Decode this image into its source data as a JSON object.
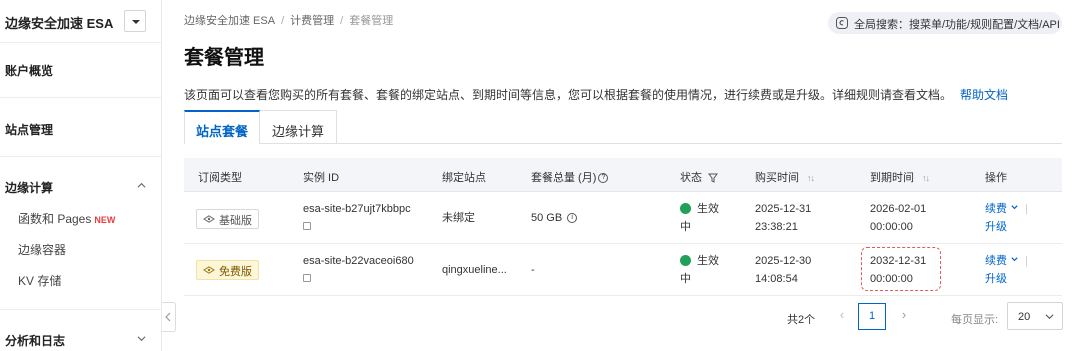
{
  "sidebar": {
    "title": "边缘安全加速 ESA",
    "items": [
      {
        "label": "账户概览"
      },
      {
        "label": "站点管理"
      },
      {
        "label": "边缘计算",
        "children": [
          {
            "label": "函数和 Pages",
            "badge": "NEW"
          },
          {
            "label": "边缘容器"
          },
          {
            "label": "KV 存储"
          }
        ]
      },
      {
        "label": "分析和日志"
      }
    ]
  },
  "breadcrumb": [
    "边缘安全加速 ESA",
    "计费管理",
    "套餐管理"
  ],
  "global_search": {
    "label": "全局搜索：搜菜单/功能/规则配置/文档/API"
  },
  "page": {
    "title": "套餐管理",
    "description": "该页面可以查看您购买的所有套餐、套餐的绑定站点、到期时间等信息，您可以根据套餐的使用情况，进行续费或是升级。详细规则请查看文档。",
    "help_link": "帮助文档"
  },
  "tabs": [
    {
      "label": "站点套餐",
      "active": true
    },
    {
      "label": "边缘计算",
      "active": false
    }
  ],
  "table": {
    "columns": [
      "订阅类型",
      "实例 ID",
      "绑定站点",
      "套餐总量 (月)",
      "状态",
      "购买时间",
      "到期时间",
      "操作"
    ],
    "rows": [
      {
        "plan": "基础版",
        "instance_id": "esa-site-b27ujt7kbbpc",
        "site": "未绑定",
        "quota": "50 GB",
        "status_1": "生效",
        "status_2": "中",
        "purchase_date": "2025-12-31",
        "purchase_time": "23:38:21",
        "expire_date": "2026-02-01",
        "expire_time": "00:00:00",
        "action_renew": "续费",
        "action_upgrade": "升级"
      },
      {
        "plan": "免费版",
        "instance_id": "esa-site-b22vaceoi680",
        "site": "qingxueline...",
        "quota": "-",
        "status_1": "生效",
        "status_2": "中",
        "purchase_date": "2025-12-30",
        "purchase_time": "14:08:54",
        "expire_date": "2032-12-31",
        "expire_time": "00:00:00",
        "action_renew": "续费",
        "action_upgrade": "升级"
      }
    ]
  },
  "pagination": {
    "total": "共2个",
    "current_page": "1",
    "page_size_label": "每页显示:",
    "page_size": "20"
  },
  "colors": {
    "accent": "#0064c8",
    "status_ok": "#21a05a",
    "highlight": "#e05b5b"
  }
}
